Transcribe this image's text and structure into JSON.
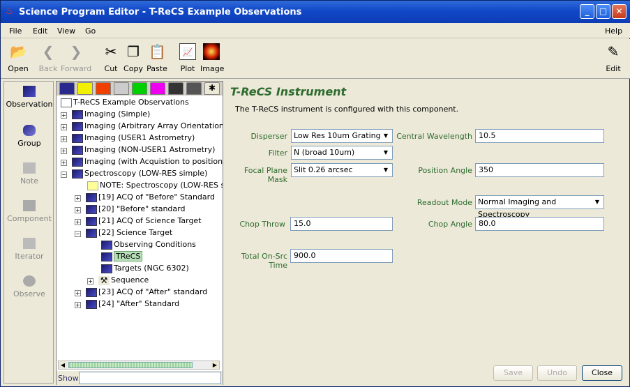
{
  "window": {
    "title": "Science Program Editor - T-ReCS Example Observations"
  },
  "menu": {
    "file": "File",
    "edit": "Edit",
    "view": "View",
    "go": "Go",
    "help": "Help"
  },
  "toolbar": {
    "open": "Open",
    "back": "Back",
    "forward": "Forward",
    "cut": "Cut",
    "copy": "Copy",
    "paste": "Paste",
    "plot": "Plot",
    "image": "Image",
    "edit": "Edit"
  },
  "palette": {
    "observation": "Observation",
    "group": "Group",
    "note": "Note",
    "component": "Component",
    "iterator": "Iterator",
    "observe": "Observe"
  },
  "tree": {
    "root": "T-ReCS Example Observations",
    "items": [
      "Imaging (Simple)",
      "Imaging (Arbitrary Array Orientation)",
      "Imaging (USER1 Astrometry)",
      "Imaging (NON-USER1 Astrometry)",
      "Imaging (with Acquistion to position on a",
      "Spectroscopy (LOW-RES simple)",
      "NOTE: Spectroscopy (LOW-RES sim",
      "[19] ACQ of \"Before\" Standard",
      "[20] \"Before\" standard",
      "[21] ACQ of Science Target",
      "[22] Science Target",
      "Observing Conditions",
      "TReCS",
      "Targets (NGC 6302)",
      "Sequence",
      "[23] ACQ of \"After\" standard",
      "[24] \"After\" Standard"
    ],
    "show_label": "Show"
  },
  "editor": {
    "title": "T-ReCS Instrument",
    "description": "The T-ReCS instrument is configured with this component.",
    "disperser_label": "Disperser",
    "disperser_value": "Low Res 10um Grating",
    "filter_label": "Filter",
    "filter_value": "N (broad 10um)",
    "fpm_label": "Focal Plane Mask",
    "fpm_value": "Slit 0.26 arcsec",
    "cw_label": "Central Wavelength",
    "cw_value": "10.5",
    "pa_label": "Position Angle",
    "pa_value": "350",
    "readout_label": "Readout Mode",
    "readout_value": "Normal Imaging and Spectroscopy",
    "chop_throw_label": "Chop Throw",
    "chop_throw_value": "15.0",
    "chop_angle_label": "Chop Angle",
    "chop_angle_value": "80.0",
    "onsrc_label": "Total On-Src Time",
    "onsrc_value": "900.0",
    "save": "Save",
    "undo": "Undo",
    "close": "Close"
  },
  "colors": {
    "accent": "#2e6b2e",
    "title_bar": "#1148c8",
    "selected_node": "#b8e0b8"
  }
}
